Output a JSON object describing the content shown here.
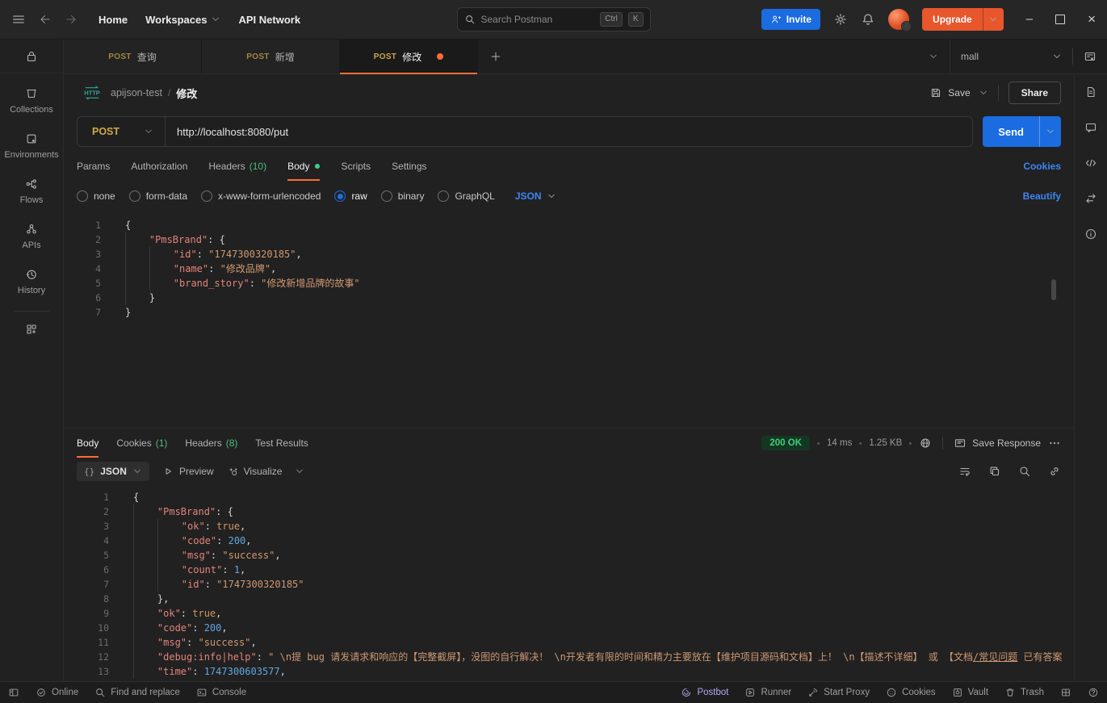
{
  "topbar": {
    "nav": [
      {
        "label": "Home"
      },
      {
        "label": "Workspaces",
        "has_chevron": true
      },
      {
        "label": "API Network"
      }
    ],
    "search": {
      "placeholder": "Search Postman",
      "shortcut": [
        "Ctrl",
        "K"
      ]
    },
    "invite_label": "Invite",
    "upgrade_label": "Upgrade"
  },
  "sidebar": {
    "items": [
      {
        "icon": "collections-icon",
        "label": "Collections"
      },
      {
        "icon": "environments-icon",
        "label": "Environments"
      },
      {
        "icon": "flows-icon",
        "label": "Flows"
      },
      {
        "icon": "apis-icon",
        "label": "APIs"
      },
      {
        "icon": "history-icon",
        "label": "History"
      }
    ]
  },
  "tabstrip": {
    "tabs": [
      {
        "method": "POST",
        "title": "查询"
      },
      {
        "method": "POST",
        "title": "新增"
      },
      {
        "method": "POST",
        "title": "修改",
        "active": true,
        "unsaved": true
      }
    ],
    "environment": "mall"
  },
  "request": {
    "breadcrumb": {
      "collection": "apijson-test",
      "separator": "/",
      "name": "修改"
    },
    "save_label": "Save",
    "share_label": "Share",
    "method": "POST",
    "url": "http://localhost:8080/put",
    "send_label": "Send",
    "tabs": [
      {
        "label": "Params"
      },
      {
        "label": "Authorization"
      },
      {
        "label": "Headers",
        "count": "(10)"
      },
      {
        "label": "Body",
        "active": true,
        "dot": true
      },
      {
        "label": "Scripts"
      },
      {
        "label": "Settings"
      }
    ],
    "cookies_link": "Cookies",
    "body_types": [
      {
        "label": "none"
      },
      {
        "label": "form-data"
      },
      {
        "label": "x-www-form-urlencoded"
      },
      {
        "label": "raw",
        "selected": true
      },
      {
        "label": "binary"
      },
      {
        "label": "GraphQL"
      }
    ],
    "language": "JSON",
    "beautify_link": "Beautify",
    "editor_lines": [
      {
        "n": 1,
        "ind": 0,
        "t": [
          {
            "c": "p",
            "x": "{"
          }
        ]
      },
      {
        "n": 2,
        "ind": 1,
        "t": [
          {
            "c": "k",
            "x": "\"PmsBrand\""
          },
          {
            "c": "p",
            "x": ": {"
          }
        ]
      },
      {
        "n": 3,
        "ind": 2,
        "t": [
          {
            "c": "k",
            "x": "\"id\""
          },
          {
            "c": "p",
            "x": ": "
          },
          {
            "c": "s",
            "x": "\"1747300320185\""
          },
          {
            "c": "p",
            "x": ","
          }
        ]
      },
      {
        "n": 4,
        "ind": 2,
        "t": [
          {
            "c": "k",
            "x": "\"name\""
          },
          {
            "c": "p",
            "x": ": "
          },
          {
            "c": "s",
            "x": "\"修改品牌\""
          },
          {
            "c": "p",
            "x": ","
          }
        ]
      },
      {
        "n": 5,
        "ind": 2,
        "t": [
          {
            "c": "k",
            "x": "\"brand_story\""
          },
          {
            "c": "p",
            "x": ": "
          },
          {
            "c": "s",
            "x": "\"修改新增品牌的故事\""
          }
        ]
      },
      {
        "n": 6,
        "ind": 1,
        "t": [
          {
            "c": "p",
            "x": "}"
          }
        ]
      },
      {
        "n": 7,
        "ind": 0,
        "t": [
          {
            "c": "p",
            "x": "}"
          }
        ]
      }
    ]
  },
  "response": {
    "tabs": [
      {
        "label": "Body",
        "active": true
      },
      {
        "label": "Cookies",
        "count": "(1)"
      },
      {
        "label": "Headers",
        "count": "(8)"
      },
      {
        "label": "Test Results"
      }
    ],
    "status": "200 OK",
    "time": "14 ms",
    "size": "1.25 KB",
    "save_label": "Save Response",
    "format": "JSON",
    "preview_label": "Preview",
    "visualize_label": "Visualize",
    "editor_lines": [
      {
        "n": 1,
        "ind": 0,
        "t": [
          {
            "c": "p",
            "x": "{"
          }
        ]
      },
      {
        "n": 2,
        "ind": 1,
        "t": [
          {
            "c": "k",
            "x": "\"PmsBrand\""
          },
          {
            "c": "p",
            "x": ": {"
          }
        ]
      },
      {
        "n": 3,
        "ind": 2,
        "t": [
          {
            "c": "k",
            "x": "\"ok\""
          },
          {
            "c": "p",
            "x": ": "
          },
          {
            "c": "b",
            "x": "true"
          },
          {
            "c": "p",
            "x": ","
          }
        ]
      },
      {
        "n": 4,
        "ind": 2,
        "t": [
          {
            "c": "k",
            "x": "\"code\""
          },
          {
            "c": "p",
            "x": ": "
          },
          {
            "c": "n",
            "x": "200"
          },
          {
            "c": "p",
            "x": ","
          }
        ]
      },
      {
        "n": 5,
        "ind": 2,
        "t": [
          {
            "c": "k",
            "x": "\"msg\""
          },
          {
            "c": "p",
            "x": ": "
          },
          {
            "c": "s",
            "x": "\"success\""
          },
          {
            "c": "p",
            "x": ","
          }
        ]
      },
      {
        "n": 6,
        "ind": 2,
        "t": [
          {
            "c": "k",
            "x": "\"count\""
          },
          {
            "c": "p",
            "x": ": "
          },
          {
            "c": "n",
            "x": "1"
          },
          {
            "c": "p",
            "x": ","
          }
        ]
      },
      {
        "n": 7,
        "ind": 2,
        "t": [
          {
            "c": "k",
            "x": "\"id\""
          },
          {
            "c": "p",
            "x": ": "
          },
          {
            "c": "s",
            "x": "\"1747300320185\""
          }
        ]
      },
      {
        "n": 8,
        "ind": 1,
        "t": [
          {
            "c": "p",
            "x": "},"
          }
        ]
      },
      {
        "n": 9,
        "ind": 1,
        "t": [
          {
            "c": "k",
            "x": "\"ok\""
          },
          {
            "c": "p",
            "x": ": "
          },
          {
            "c": "b",
            "x": "true"
          },
          {
            "c": "p",
            "x": ","
          }
        ]
      },
      {
        "n": 10,
        "ind": 1,
        "t": [
          {
            "c": "k",
            "x": "\"code\""
          },
          {
            "c": "p",
            "x": ": "
          },
          {
            "c": "n",
            "x": "200"
          },
          {
            "c": "p",
            "x": ","
          }
        ]
      },
      {
        "n": 11,
        "ind": 1,
        "t": [
          {
            "c": "k",
            "x": "\"msg\""
          },
          {
            "c": "p",
            "x": ": "
          },
          {
            "c": "s",
            "x": "\"success\""
          },
          {
            "c": "p",
            "x": ","
          }
        ]
      },
      {
        "n": 12,
        "ind": 1,
        "t": [
          {
            "c": "k",
            "x": "\"debug:info|help\""
          },
          {
            "c": "p",
            "x": ": "
          },
          {
            "c": "s",
            "x": "\" \\n提 bug 请发请求和响应的【完整截屏】，没图的自行解决！ \\n开发者有限的时间和精力主要放在【维护项目源码和文档】上！ \\n【描述不详细】 或 【文档"
          },
          {
            "c": "s",
            "u": true,
            "x": "/常见问题"
          },
          {
            "c": "s",
            "x": " 已有答案"
          }
        ]
      },
      {
        "n": 13,
        "ind": 1,
        "t": [
          {
            "c": "k",
            "x": "\"time\""
          },
          {
            "c": "p",
            "x": ": "
          },
          {
            "c": "n",
            "x": "1747300603577"
          },
          {
            "c": "p",
            "x": ","
          }
        ]
      }
    ]
  },
  "footer": {
    "left": [
      {
        "icon": "sidebar-toggle-icon"
      },
      {
        "icon": "online-status-icon",
        "label": "Online"
      },
      {
        "icon": "search-icon",
        "label": "Find and replace"
      },
      {
        "icon": "console-icon",
        "label": "Console"
      }
    ],
    "right": [
      {
        "icon": "postbot-icon",
        "label": "Postbot",
        "accent": true
      },
      {
        "icon": "runner-icon",
        "label": "Runner"
      },
      {
        "icon": "proxy-icon",
        "label": "Start Proxy"
      },
      {
        "icon": "cookie-icon",
        "label": "Cookies"
      },
      {
        "icon": "vault-icon",
        "label": "Vault"
      },
      {
        "icon": "trash-icon",
        "label": "Trash"
      },
      {
        "icon": "panes-icon"
      },
      {
        "icon": "help-icon"
      }
    ]
  },
  "rail": {
    "icons": [
      "documentation-icon",
      "comment-icon",
      "code-icon",
      "related-requests-icon",
      "info-icon"
    ]
  },
  "colors": {
    "accent_orange": "#ff6c37",
    "post_method_gold": "#c9a64b",
    "count_green": "#4dbb7f",
    "link_blue": "#3d86f2",
    "send_blue": "#1a6ce0",
    "status_text_green": "#3fd07a",
    "status_badge_bg": "#143723",
    "upgrade_orange": "#e8562c"
  }
}
